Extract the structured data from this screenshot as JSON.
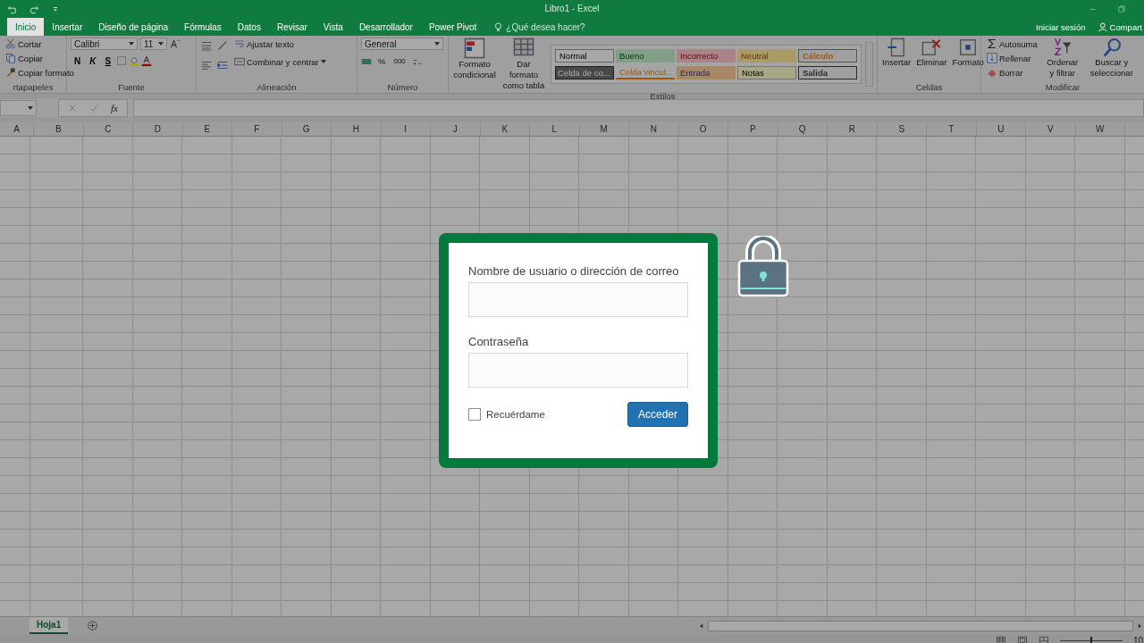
{
  "window": {
    "title": "Libro1 - Excel"
  },
  "tabs": [
    {
      "label": "Inicio",
      "selected": true
    },
    {
      "label": "Insertar",
      "selected": false
    },
    {
      "label": "Diseño de página",
      "selected": false
    },
    {
      "label": "Fórmulas",
      "selected": false
    },
    {
      "label": "Datos",
      "selected": false
    },
    {
      "label": "Revisar",
      "selected": false
    },
    {
      "label": "Vista",
      "selected": false
    },
    {
      "label": "Desarrollador",
      "selected": false
    },
    {
      "label": "Power Pivot",
      "selected": false
    }
  ],
  "tell_me": {
    "placeholder": "¿Qué desea hacer?"
  },
  "account": {
    "sign_in": "Iniciar sesión",
    "share": "Compart"
  },
  "ribbon": {
    "clipboard": {
      "label": "rtapapeles",
      "items": [
        "Cortar",
        "Copiar",
        "Copiar formato"
      ]
    },
    "font": {
      "label": "Fuente",
      "font_name": "Calibri",
      "font_size": "11",
      "styles": [
        "N",
        "K",
        "S"
      ]
    },
    "alignment": {
      "label": "Alineación",
      "wrap": "Ajustar texto",
      "merge": "Combinar y centrar"
    },
    "number": {
      "label": "Número",
      "format": "General",
      "percent": "%",
      "thousands": "000"
    },
    "styles": {
      "label": "Estilos",
      "conditional": "Formato condicional",
      "as_table": "Dar formato como tabla",
      "gallery": [
        {
          "label": "Normal",
          "kind": "normal"
        },
        {
          "label": "Bueno",
          "kind": "good"
        },
        {
          "label": "Incorrecto",
          "kind": "bad"
        },
        {
          "label": "Neutral",
          "kind": "neutral"
        },
        {
          "label": "Cálculo",
          "kind": "calc"
        },
        {
          "label": "Celda de co...",
          "kind": "check"
        },
        {
          "label": "Celda vincul...",
          "kind": "linked"
        },
        {
          "label": "Entrada",
          "kind": "input"
        },
        {
          "label": "Notas",
          "kind": "note"
        },
        {
          "label": "Salida",
          "kind": "output"
        }
      ]
    },
    "cells": {
      "label": "Celdas",
      "items": [
        "Insertar",
        "Eliminar",
        "Formato"
      ]
    },
    "editing": {
      "label": "Modificar",
      "autosum": "Autosuma",
      "fill": "Rellenar",
      "clear": "Borrar",
      "sort": "Ordenar y filtrar",
      "find": "Buscar y seleccionar"
    }
  },
  "formula_bar": {
    "function_label": "fx"
  },
  "columns": [
    "A",
    "B",
    "C",
    "D",
    "E",
    "F",
    "G",
    "H",
    "I",
    "J",
    "K",
    "L",
    "M",
    "N",
    "O",
    "P",
    "Q",
    "R",
    "S",
    "T",
    "U",
    "V",
    "W"
  ],
  "sheets": [
    {
      "label": "Hoja1",
      "selected": true
    }
  ],
  "zoom_slider": {
    "level": 0.5
  },
  "zoom": "10",
  "login": {
    "username_label": "Nombre de usuario o dirección de correo",
    "password_label": "Contraseña",
    "remember": {
      "label": "Recuérdame",
      "checked": false
    },
    "submit": "Acceder"
  }
}
